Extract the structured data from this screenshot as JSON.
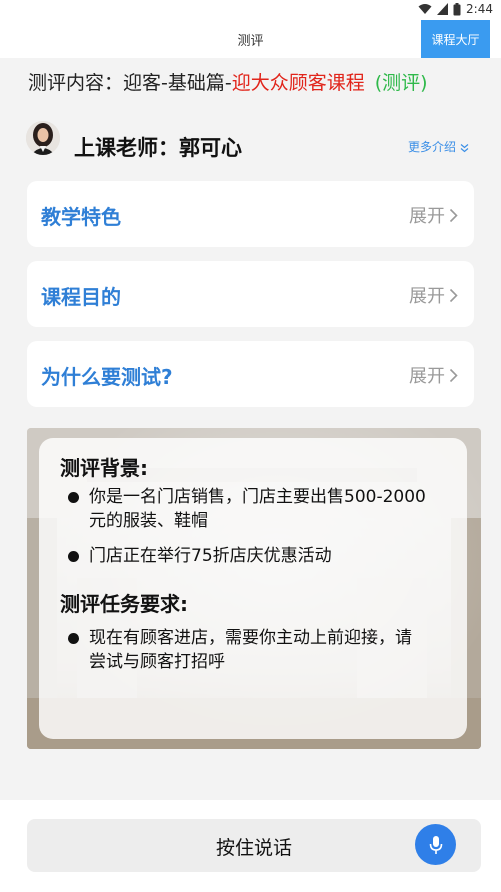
{
  "status_bar": {
    "time": "2:44"
  },
  "nav": {
    "title": "测评",
    "hall_button": "课程大厅"
  },
  "content": {
    "prefix": "测评内容：迎客-基础篇-",
    "course_name": "迎大众顾客课程",
    "tag": "(测评)"
  },
  "teacher": {
    "label": "上课老师：郭可心",
    "more_link": "更多介绍"
  },
  "sections": [
    {
      "title": "教学特色",
      "expand_label": "展开"
    },
    {
      "title": "课程目的",
      "expand_label": "展开"
    },
    {
      "title": "为什么要测试?",
      "expand_label": "展开"
    }
  ],
  "scene": {
    "background_heading": "测评背景:",
    "background_items": [
      "你是一名门店销售，门店主要出售500-2000元的服装、鞋帽",
      "门店正在举行75折店庆优惠活动"
    ],
    "task_heading": "测评任务要求:",
    "task_items": [
      "现在有顾客进店，需要你主动上前迎接，请尝试与顾客打招呼"
    ]
  },
  "bottom": {
    "talk_button": "按住说话"
  },
  "colors": {
    "accent": "#3a9bf0",
    "section_title": "#2f7fd6",
    "course_red": "#e1251b",
    "tag_green": "#2fb94a"
  }
}
